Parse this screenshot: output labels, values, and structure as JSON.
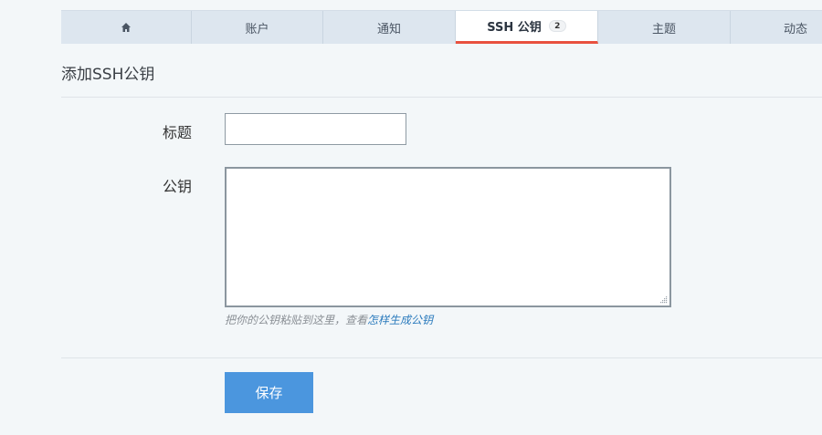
{
  "tabs": [
    {
      "id": "home",
      "icon": "home-icon",
      "label": ""
    },
    {
      "id": "account",
      "label": "账户"
    },
    {
      "id": "notifications",
      "label": "通知"
    },
    {
      "id": "ssh-keys",
      "label": "SSH 公钥",
      "badge": "2",
      "active": true
    },
    {
      "id": "theme",
      "label": "主题"
    },
    {
      "id": "activity",
      "label": "动态"
    }
  ],
  "form": {
    "heading": "添加SSH公钥",
    "title_label": "标题",
    "title_value": "",
    "key_label": "公钥",
    "key_value": "",
    "hint_text": "把你的公钥粘贴到这里，查看",
    "hint_link": "怎样生成公钥",
    "save_label": "保存"
  },
  "colors": {
    "active_tab_underline": "#e8513f",
    "save_button": "#4b96de",
    "link": "#2b7bbd"
  }
}
